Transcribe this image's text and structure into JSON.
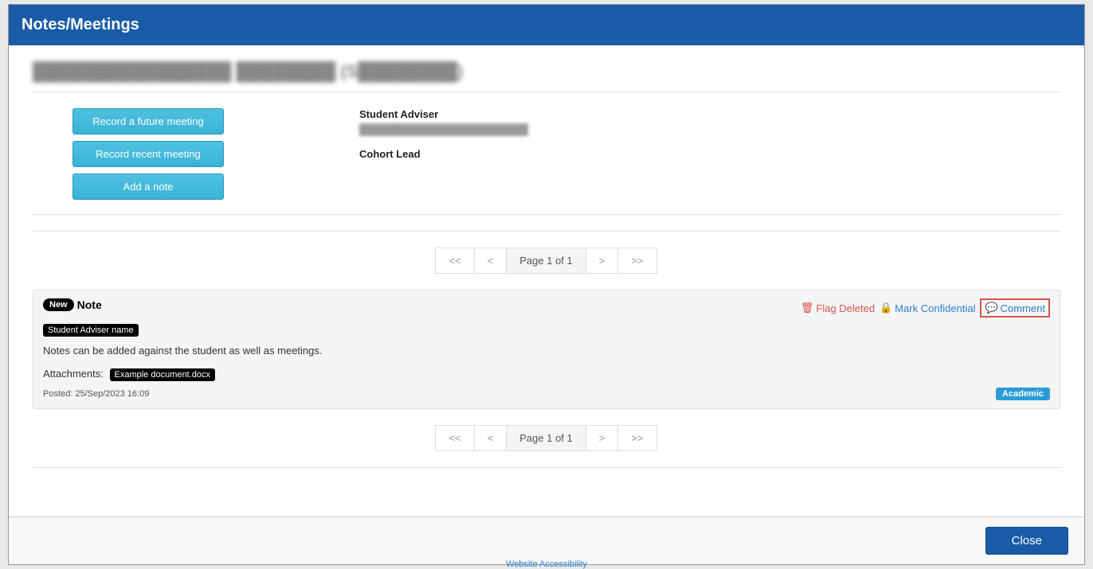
{
  "modal": {
    "title": "Notes/Meetings",
    "student_name": "████████████████ ████████ (S████████)",
    "close_label": "Close"
  },
  "actions": {
    "future_meeting": "Record a future meeting",
    "recent_meeting": "Record recent meeting",
    "add_note": "Add a note"
  },
  "info": {
    "adviser_label": "Student Adviser",
    "adviser_value": "███████████████████████",
    "cohort_label": "Cohort Lead",
    "cohort_value": ""
  },
  "pagination": {
    "first": "<<",
    "prev": "<",
    "current": "Page 1 of 1",
    "next": ">",
    "last": ">>"
  },
  "note": {
    "new_badge": "New",
    "title": "Note",
    "author": "Student Adviser name",
    "body": "Notes can be added against the student as well as meetings.",
    "attachments_label": "Attachments:",
    "attachment_file": "Example document.docx",
    "posted": "Posted: 25/Sep/2023 16:09",
    "category": "Academic",
    "action_flag": "Flag Deleted",
    "action_conf": "Mark Confidential",
    "action_comment": "Comment"
  },
  "bg": {
    "footer_link": "Website Accessibility"
  }
}
